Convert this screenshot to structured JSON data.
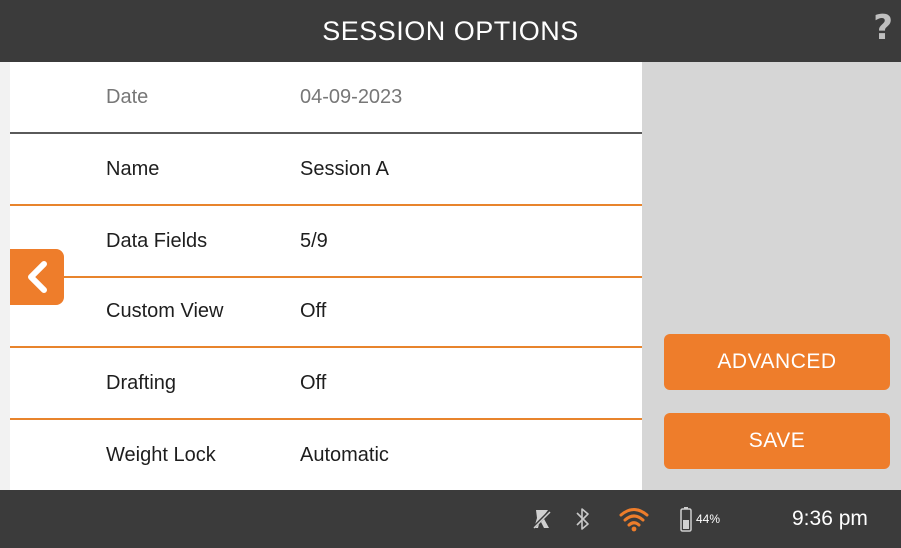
{
  "header": {
    "title": "SESSION OPTIONS",
    "help_label": "?"
  },
  "options": [
    {
      "label": "Date",
      "value": "04-09-2023"
    },
    {
      "label": "Name",
      "value": "Session A"
    },
    {
      "label": "Data Fields",
      "value": "5/9"
    },
    {
      "label": "Custom View",
      "value": "Off"
    },
    {
      "label": "Drafting",
      "value": "Off"
    },
    {
      "label": "Weight Lock",
      "value": "Automatic"
    }
  ],
  "actions": {
    "advanced_label": "ADVANCED",
    "save_label": "SAVE"
  },
  "status": {
    "icons": [
      "no-gps-icon",
      "bluetooth-icon",
      "wifi-icon",
      "battery-icon"
    ],
    "battery_level": "44%",
    "time": "9:36 pm"
  },
  "colors": {
    "accent": "#ee7d2b",
    "bar": "#3b3b3b",
    "panel": "#d6d6d6"
  }
}
